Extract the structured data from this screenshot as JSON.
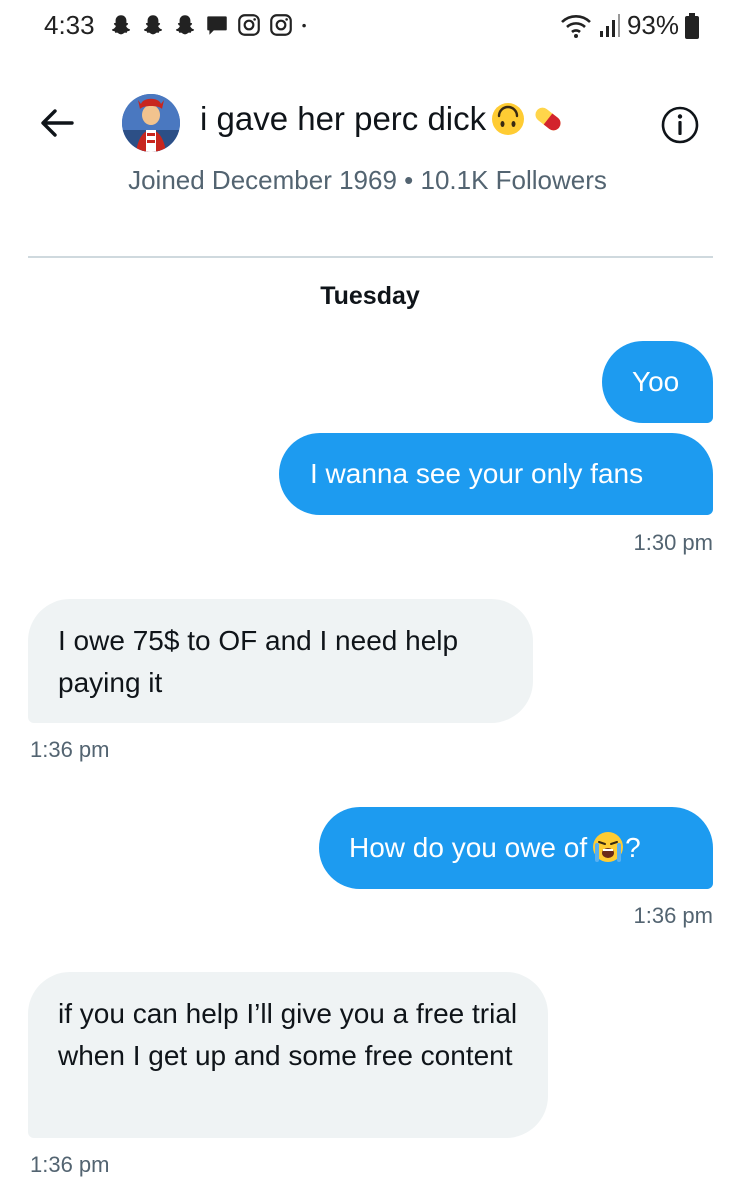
{
  "status_bar": {
    "time": "4:33",
    "left_icons": [
      "snapchat-icon",
      "snapchat-icon",
      "snapchat-icon",
      "message-icon",
      "instagram-icon",
      "instagram-icon",
      "dot-icon"
    ],
    "right_icons": [
      "wifi-icon",
      "signal-icon",
      "battery-icon"
    ],
    "battery": "93%"
  },
  "header": {
    "title": "i gave her perc dick",
    "title_emojis": [
      "upside-down-face-emoji",
      "pill-emoji"
    ],
    "joined": "Joined December 1969 • 10.1K Followers"
  },
  "conversation": {
    "day": "Tuesday",
    "messages": [
      {
        "direction": "sent",
        "text": "Yoo"
      },
      {
        "direction": "sent",
        "text": "I wanna see your only fans",
        "time": "1:30 pm"
      },
      {
        "direction": "received",
        "text": "I owe 75$ to OF and I need help paying it",
        "time": "1:36 pm"
      },
      {
        "direction": "sent",
        "text": "How do you owe of",
        "emoji": "loudly-crying-face-emoji",
        "suffix": "?",
        "time": "1:36 pm"
      },
      {
        "direction": "received",
        "text": "if you can help I’ll give you a free trial when I get up and some free content",
        "time": "1:36 pm"
      }
    ]
  },
  "colors": {
    "sent_bubble": "#1d9bf0",
    "received_bubble": "#eff3f4",
    "secondary_text": "#536471",
    "divider": "#cfd9de"
  }
}
